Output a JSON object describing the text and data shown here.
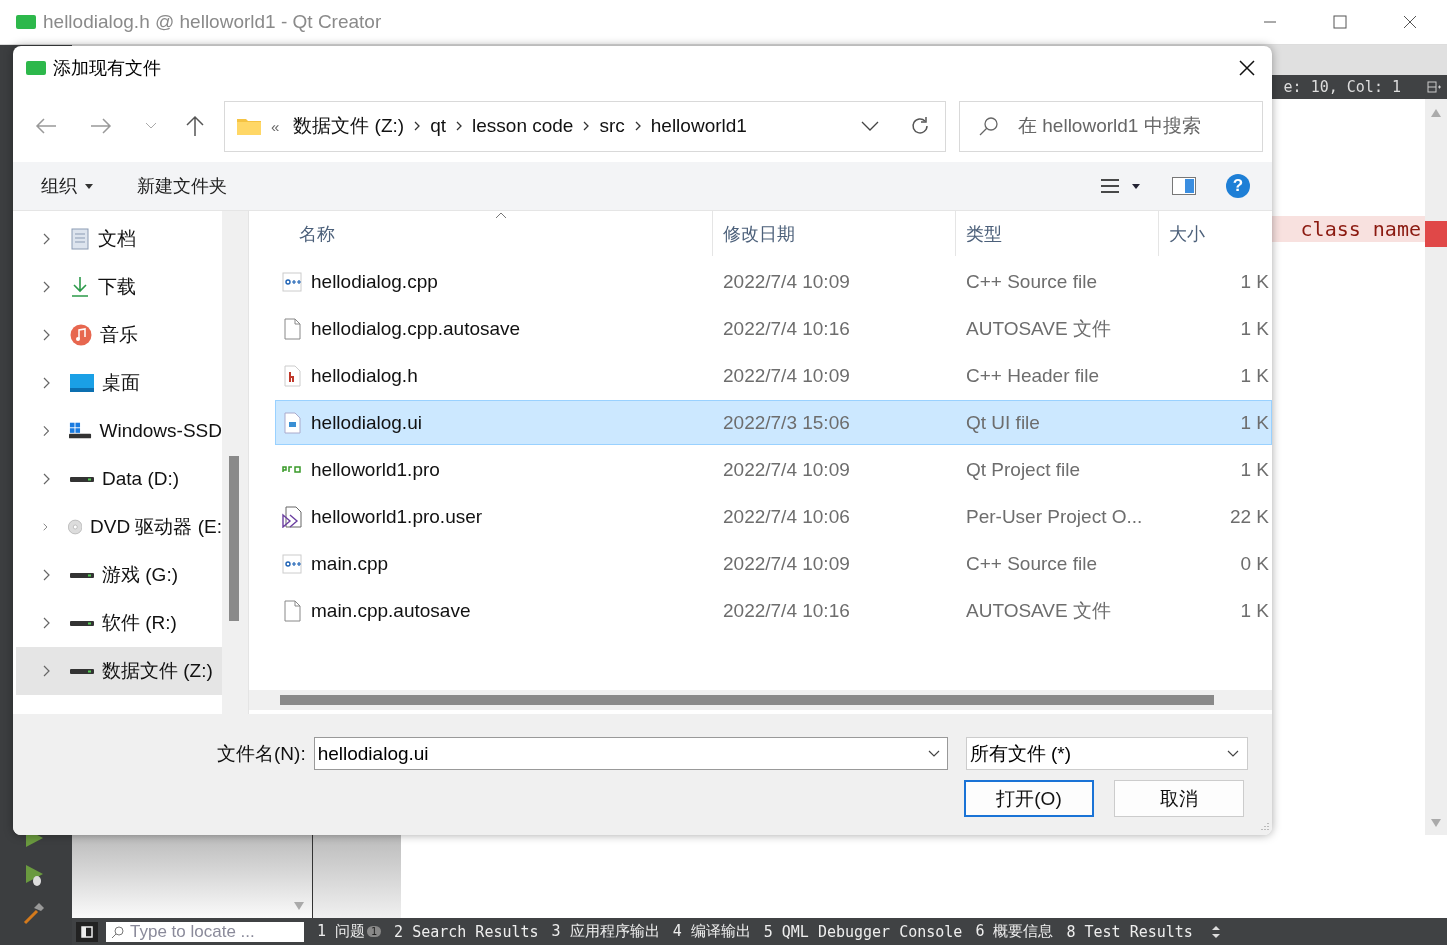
{
  "window": {
    "title": "hellodialog.h @ helloworld1 - Qt Creator"
  },
  "editor": {
    "position": "e: 10, Col: 1",
    "highlighted_line": "class name"
  },
  "locator": {
    "placeholder": "Type to locate ..."
  },
  "output_tabs": [
    {
      "label": "1 问题",
      "badge": "1"
    },
    {
      "label": "2 Search Results"
    },
    {
      "label": "3 应用程序输出"
    },
    {
      "label": "4 编译输出"
    },
    {
      "label": "5 QML Debugger Console"
    },
    {
      "label": "6 概要信息"
    },
    {
      "label": "8 Test Results"
    }
  ],
  "dialog": {
    "title": "添加现有文件",
    "overflow_mark": "«",
    "breadcrumbs": [
      "数据文件 (Z:)",
      "qt",
      "lesson code",
      "src",
      "helloworld1"
    ],
    "search": {
      "placeholder": "在 helloworld1 中搜索"
    },
    "toolbar": {
      "organize": "组织",
      "new_folder": "新建文件夹",
      "help": "?"
    },
    "nav": [
      {
        "label": "文档",
        "kind": "documents",
        "selected": false
      },
      {
        "label": "下载",
        "kind": "download",
        "selected": false
      },
      {
        "label": "音乐",
        "kind": "music",
        "selected": false
      },
      {
        "label": "桌面",
        "kind": "desktop",
        "selected": false
      },
      {
        "label": "Windows-SSD",
        "kind": "system",
        "selected": false
      },
      {
        "label": "Data (D:)",
        "kind": "drive",
        "selected": false
      },
      {
        "label": "DVD 驱动器 (E:",
        "kind": "dvd",
        "selected": false
      },
      {
        "label": "游戏 (G:)",
        "kind": "drive",
        "selected": false
      },
      {
        "label": "软件 (R:)",
        "kind": "drive",
        "selected": false
      },
      {
        "label": "数据文件 (Z:)",
        "kind": "drive",
        "selected": true
      }
    ],
    "columns": [
      "名称",
      "修改日期",
      "类型",
      "大小"
    ],
    "files": [
      {
        "name": "hellodialog.cpp",
        "modified": "2022/7/4 10:09",
        "type": "C++ Source file",
        "size": "1 K",
        "kind": "cpp",
        "selected": false
      },
      {
        "name": "hellodialog.cpp.autosave",
        "modified": "2022/7/4 10:16",
        "type": "AUTOSAVE 文件",
        "size": "1 K",
        "kind": "blank",
        "selected": false
      },
      {
        "name": "hellodialog.h",
        "modified": "2022/7/4 10:09",
        "type": "C++ Header file",
        "size": "1 K",
        "kind": "header",
        "selected": false
      },
      {
        "name": "hellodialog.ui",
        "modified": "2022/7/3 15:06",
        "type": "Qt UI file",
        "size": "1 K",
        "kind": "ui",
        "selected": true
      },
      {
        "name": "helloworld1.pro",
        "modified": "2022/7/4 10:09",
        "type": "Qt Project file",
        "size": "1 K",
        "kind": "pro",
        "selected": false
      },
      {
        "name": "helloworld1.pro.user",
        "modified": "2022/7/4 10:06",
        "type": "Per-User Project O...",
        "size": "22 K",
        "kind": "user",
        "selected": false
      },
      {
        "name": "main.cpp",
        "modified": "2022/7/4 10:09",
        "type": "C++ Source file",
        "size": "0 K",
        "kind": "cpp",
        "selected": false
      },
      {
        "name": "main.cpp.autosave",
        "modified": "2022/7/4 10:16",
        "type": "AUTOSAVE 文件",
        "size": "1 K",
        "kind": "blank",
        "selected": false
      }
    ],
    "filename": {
      "label": "文件名(N):",
      "value": "hellodialog.ui"
    },
    "filter": "所有文件 (*)",
    "buttons": [
      {
        "label": "打开(O)",
        "default": true
      },
      {
        "label": "取消",
        "default": false
      }
    ]
  }
}
